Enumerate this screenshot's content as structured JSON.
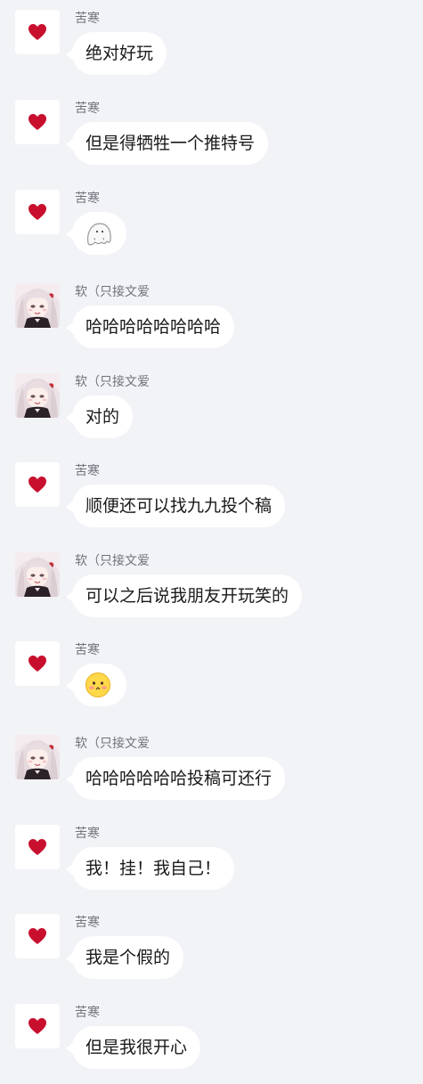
{
  "colors": {
    "background": "#f2f3f7",
    "bubble": "#ffffff",
    "heart": "#c8102e"
  },
  "messages": [
    {
      "sender": "苦寒",
      "avatar": "heart-avatar",
      "text": "绝对好玩"
    },
    {
      "sender": "苦寒",
      "avatar": "heart-avatar",
      "text": "但是得牺牲一个推特号"
    },
    {
      "sender": "苦寒",
      "avatar": "heart-avatar",
      "emoji": "ghost-emoji"
    },
    {
      "sender": "软（只接文爱",
      "avatar": "anime-girl-avatar",
      "text": "哈哈哈哈哈哈哈哈"
    },
    {
      "sender": "软（只接文爱",
      "avatar": "anime-girl-avatar",
      "text": "对的"
    },
    {
      "sender": "苦寒",
      "avatar": "heart-avatar",
      "text": "顺便还可以找九九投个稿"
    },
    {
      "sender": "软（只接文爱",
      "avatar": "anime-girl-avatar",
      "text": "可以之后说我朋友开玩笑的"
    },
    {
      "sender": "苦寒",
      "avatar": "heart-avatar",
      "emoji": "shy-face-emoji"
    },
    {
      "sender": "软（只接文爱",
      "avatar": "anime-girl-avatar",
      "text": "哈哈哈哈哈哈投稿可还行"
    },
    {
      "sender": "苦寒",
      "avatar": "heart-avatar",
      "text": "我！挂！我自己！"
    },
    {
      "sender": "苦寒",
      "avatar": "heart-avatar",
      "text": "我是个假的"
    },
    {
      "sender": "苦寒",
      "avatar": "heart-avatar",
      "text": "但是我很开心"
    }
  ]
}
